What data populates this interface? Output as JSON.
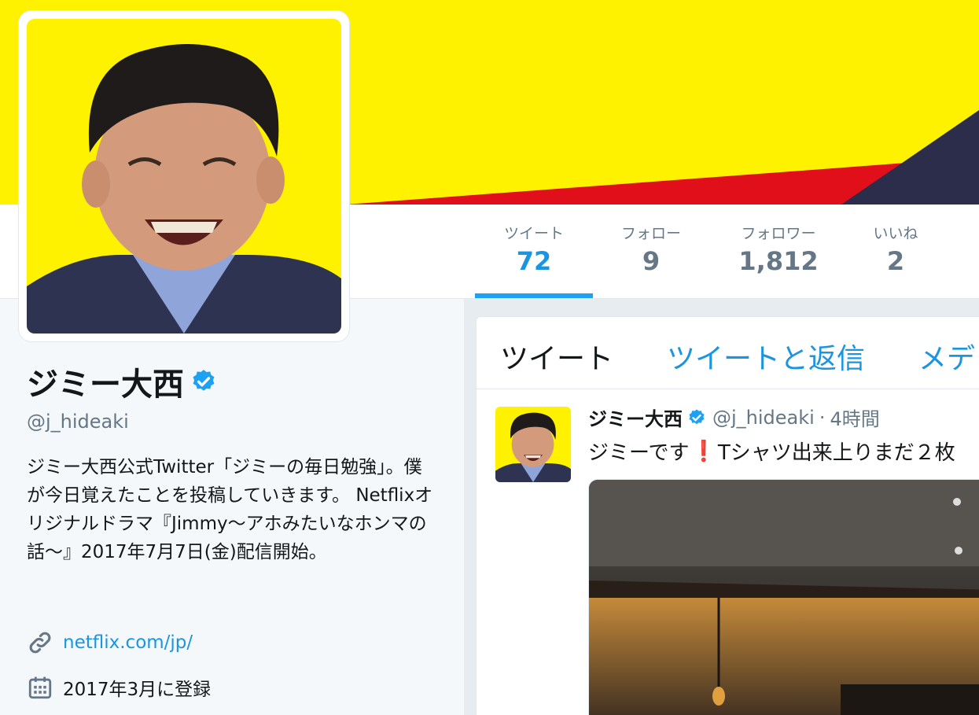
{
  "profile": {
    "name": "ジミー大西",
    "handle": "@j_hideaki",
    "bio": "ジミー大西公式Twitter「ジミーの毎日勉強」。僕が今日覚えたことを投稿していきます。 Netflixオリジナルドラマ『Jimmy〜アホみたいなホンマの話〜』2017年7月7日(金)配信開始。",
    "url": "netflix.com/jp/",
    "joined": "2017年3月に登録"
  },
  "stats": [
    {
      "label": "ツイート",
      "value": "72"
    },
    {
      "label": "フォロー",
      "value": "9"
    },
    {
      "label": "フォロワー",
      "value": "1,812"
    },
    {
      "label": "いいね",
      "value": "2"
    }
  ],
  "tabs": [
    "ツイート",
    "ツイートと返信",
    "メデ"
  ],
  "tweet": {
    "name": "ジミー大西",
    "handle": "@j_hideaki",
    "separator": "·",
    "time": "4時間",
    "text_before": "ジミーです",
    "text_mark": "❗",
    "text_after": "Tシャツ出来上りまだ２枚"
  },
  "colors": {
    "banner": "#fff200",
    "accent": "#1da1f2",
    "link": "#1b95e0",
    "muted": "#657786"
  },
  "icons": {
    "verified": "verified-badge-icon",
    "link": "link-icon",
    "calendar": "calendar-icon"
  }
}
